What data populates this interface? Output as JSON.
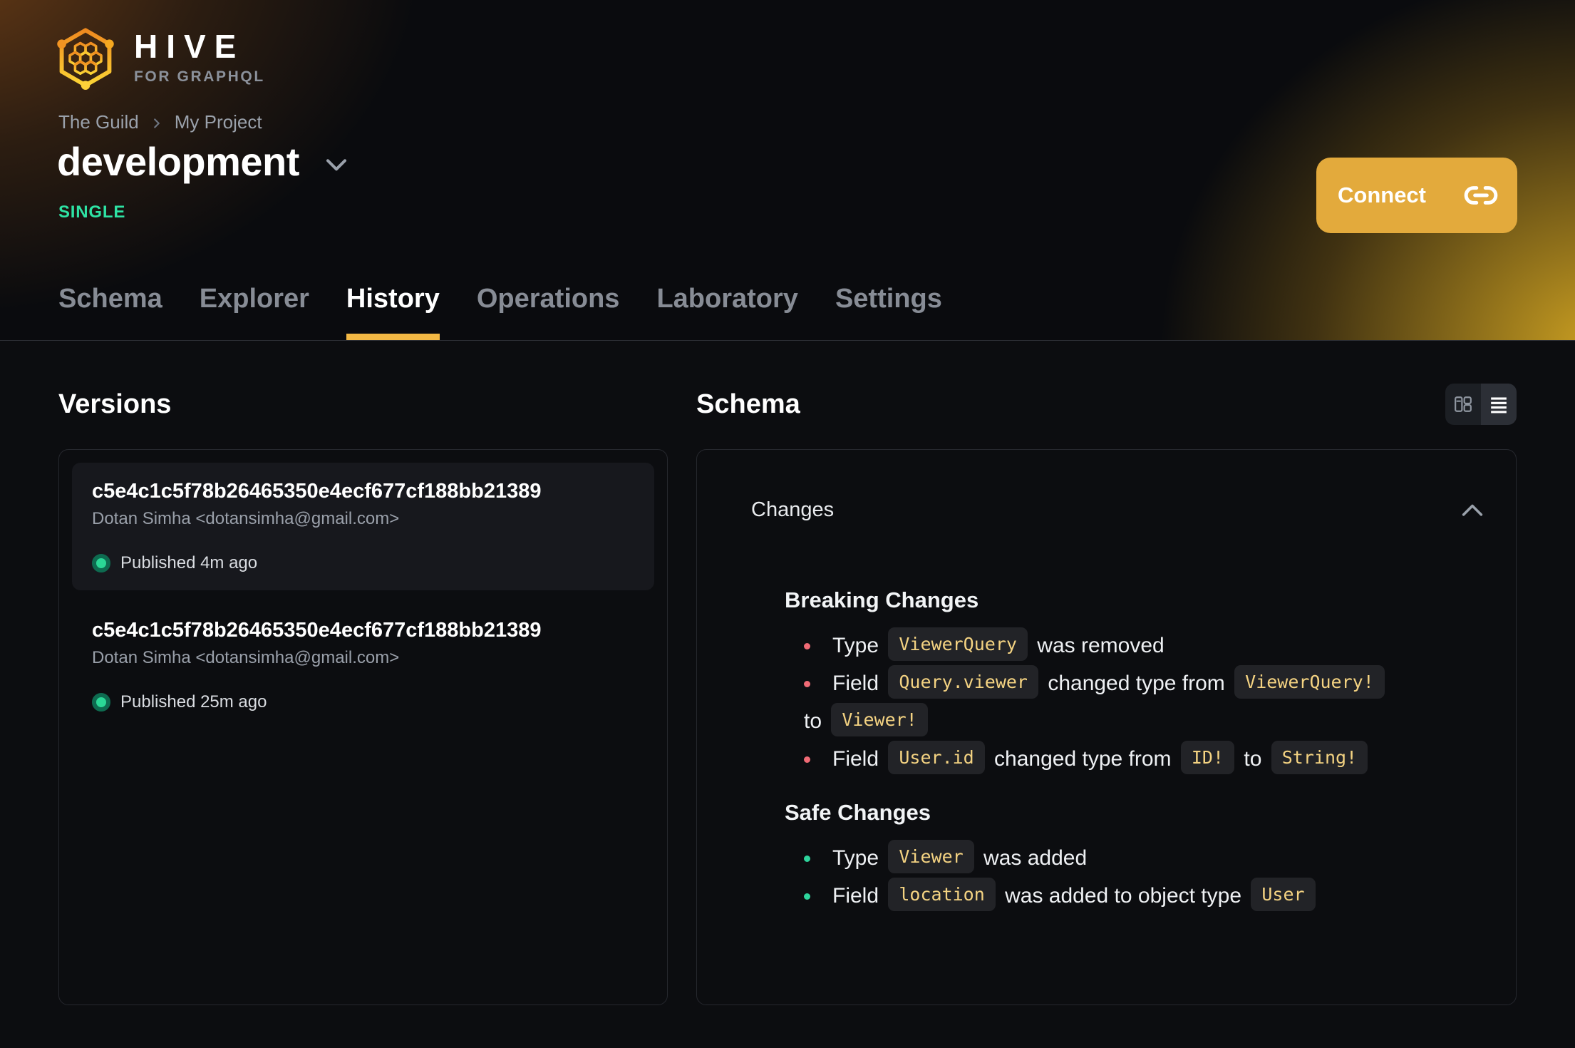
{
  "brand": {
    "name": "HIVE",
    "tagline": "FOR GRAPHQL"
  },
  "breadcrumb": {
    "items": [
      "The Guild",
      "My Project"
    ]
  },
  "target": {
    "name": "development",
    "badge": "SINGLE"
  },
  "actions": {
    "connect_label": "Connect",
    "connect_icon": "link-icon"
  },
  "tabs": {
    "active_index": 2,
    "items": [
      {
        "label": "Schema"
      },
      {
        "label": "Explorer"
      },
      {
        "label": "History"
      },
      {
        "label": "Operations"
      },
      {
        "label": "Laboratory"
      },
      {
        "label": "Settings"
      }
    ]
  },
  "versions": {
    "title": "Versions",
    "items": [
      {
        "hash": "c5e4c1c5f78b26465350e4ecf677cf188bb21389",
        "author": "Dotan Simha <dotansimha@gmail.com>",
        "status": "Published 4m ago",
        "selected": true
      },
      {
        "hash": "c5e4c1c5f78b26465350e4ecf677cf188bb21389",
        "author": "Dotan Simha <dotansimha@gmail.com>",
        "status": "Published 25m ago",
        "selected": false
      }
    ]
  },
  "schema": {
    "title": "Schema",
    "view_toggle": {
      "options": [
        "columns-view",
        "list-view"
      ],
      "active": "list-view"
    },
    "changes": {
      "title": "Changes",
      "collapsed": false,
      "sections": [
        {
          "title": "Breaking Changes",
          "severity": "breaking",
          "items": [
            {
              "segments": [
                {
                  "t": "text",
                  "v": "Type "
                },
                {
                  "t": "code",
                  "v": "ViewerQuery"
                },
                {
                  "t": "text",
                  "v": " was removed"
                }
              ]
            },
            {
              "segments": [
                {
                  "t": "text",
                  "v": "Field "
                },
                {
                  "t": "code",
                  "v": "Query.viewer"
                },
                {
                  "t": "text",
                  "v": " changed type from "
                },
                {
                  "t": "code",
                  "v": "ViewerQuery!"
                },
                {
                  "t": "break"
                },
                {
                  "t": "text",
                  "v": "to "
                },
                {
                  "t": "code",
                  "v": "Viewer!"
                }
              ]
            },
            {
              "segments": [
                {
                  "t": "text",
                  "v": "Field "
                },
                {
                  "t": "code",
                  "v": "User.id"
                },
                {
                  "t": "text",
                  "v": " changed type from "
                },
                {
                  "t": "code",
                  "v": "ID!"
                },
                {
                  "t": "text",
                  "v": " to "
                },
                {
                  "t": "code",
                  "v": "String!"
                }
              ]
            }
          ]
        },
        {
          "title": "Safe Changes",
          "severity": "safe",
          "items": [
            {
              "segments": [
                {
                  "t": "text",
                  "v": "Type "
                },
                {
                  "t": "code",
                  "v": "Viewer"
                },
                {
                  "t": "text",
                  "v": " was added"
                }
              ]
            },
            {
              "segments": [
                {
                  "t": "text",
                  "v": "Field "
                },
                {
                  "t": "code",
                  "v": "location"
                },
                {
                  "t": "text",
                  "v": " was added to object type "
                },
                {
                  "t": "code",
                  "v": "User"
                }
              ]
            }
          ]
        }
      ]
    }
  },
  "colors": {
    "accent": "#e3aa3c",
    "tab_underline": "#f3b844",
    "badge_green": "#2ee3a4",
    "published_dot": "#2bd796",
    "breaking_bullet": "#f06a75",
    "safe_bullet": "#2ed49c",
    "code_text": "#f4d382",
    "code_bg": "#222327"
  }
}
